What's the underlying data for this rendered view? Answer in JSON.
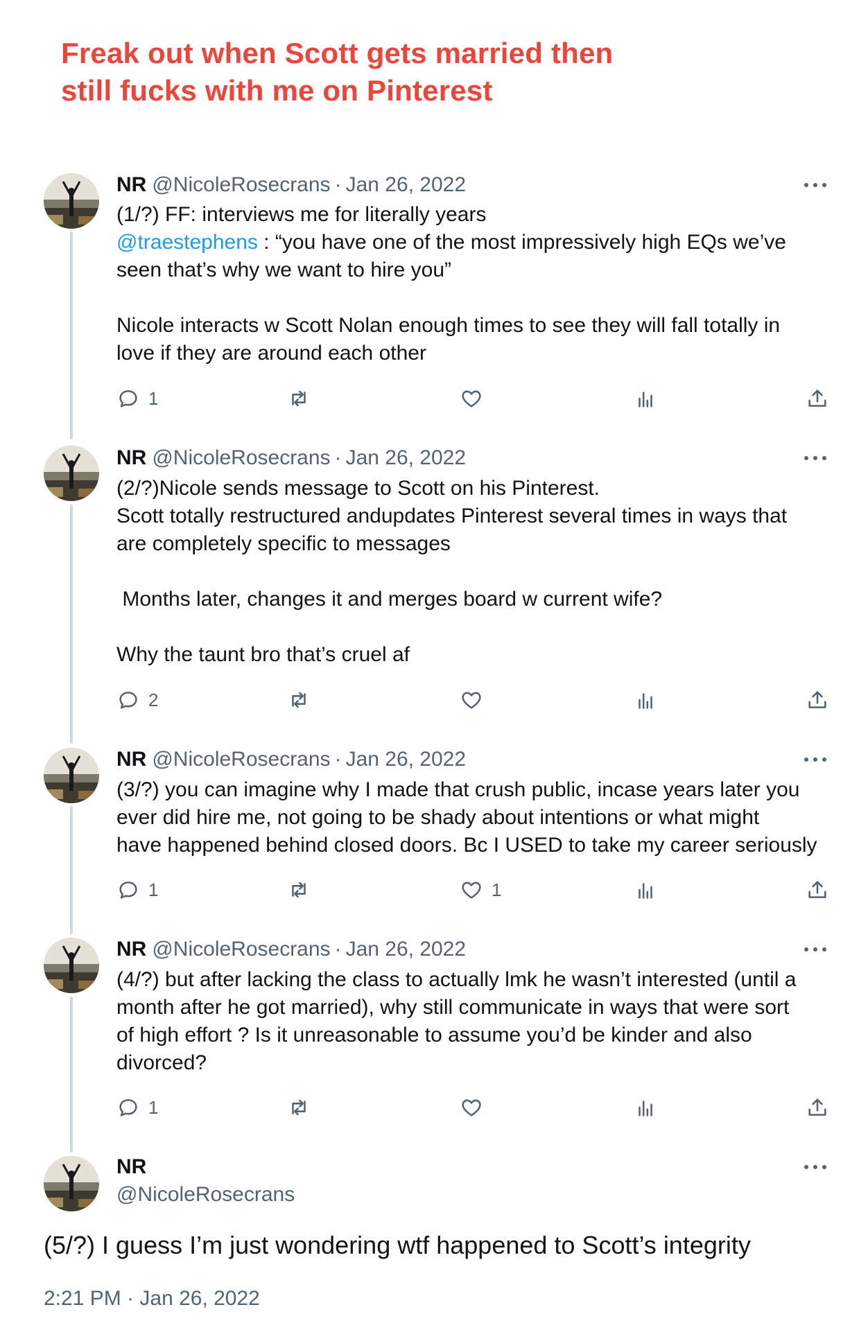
{
  "headline": {
    "line1": "Freak out when Scott gets married then",
    "line2": "still fucks with me on Pinterest"
  },
  "author": {
    "name": "NR",
    "handle": "@NicoleRosecrans"
  },
  "tweets": [
    {
      "date": "Jan 26, 2022",
      "lines": [
        "(1/?) FF: interviews me for literally years",
        "",
        "seen that’s why we want to hire you”",
        "",
        "Nicole interacts w Scott Nolan enough times to see they will fall totally in",
        "love if they are around each other"
      ],
      "mention": "@traestephens",
      "mention_rest": " : “you have one of the most impressively high EQs we’ve",
      "replies": "1",
      "likes": ""
    },
    {
      "date": "Jan 26, 2022",
      "lines": [
        "(2/?)Nicole sends message to Scott on his Pinterest.",
        "Scott totally restructured andupdates Pinterest several times in ways that",
        "are completely specific to messages",
        "",
        " Months later, changes it and merges board w current wife?",
        "",
        "Why the taunt bro that’s cruel af"
      ],
      "replies": "2",
      "likes": ""
    },
    {
      "date": "Jan 26, 2022",
      "lines": [
        "(3/?) you can imagine why I made that crush public, incase years later you",
        "ever did hire me, not going to be shady about intentions or what might",
        "have happened behind closed doors. Bc I USED to take my career seriously"
      ],
      "replies": "1",
      "likes": "1"
    },
    {
      "date": "Jan 26, 2022",
      "lines": [
        "(4/?) but after lacking the class to actually lmk he wasn’t interested (until a",
        "month after he got married), why still communicate in ways that were sort",
        "of high effort ? Is it unreasonable to assume you’d be kinder and also",
        "divorced?"
      ],
      "replies": "1",
      "likes": ""
    }
  ],
  "final_tweet": {
    "text": "(5/?) I guess I’m just wondering wtf happened to Scott’s integrity",
    "timestamp": "2:21 PM · Jan 26, 2022"
  },
  "separator": "·",
  "colors": {
    "headline": "#ef4437",
    "text": "#0f1419",
    "secondary": "#536471",
    "mention": "#1d9bf0",
    "thread_line": "#cfd9de"
  },
  "icons": [
    "reply-icon",
    "retweet-icon",
    "like-icon",
    "views-icon",
    "share-icon",
    "more-icon"
  ]
}
